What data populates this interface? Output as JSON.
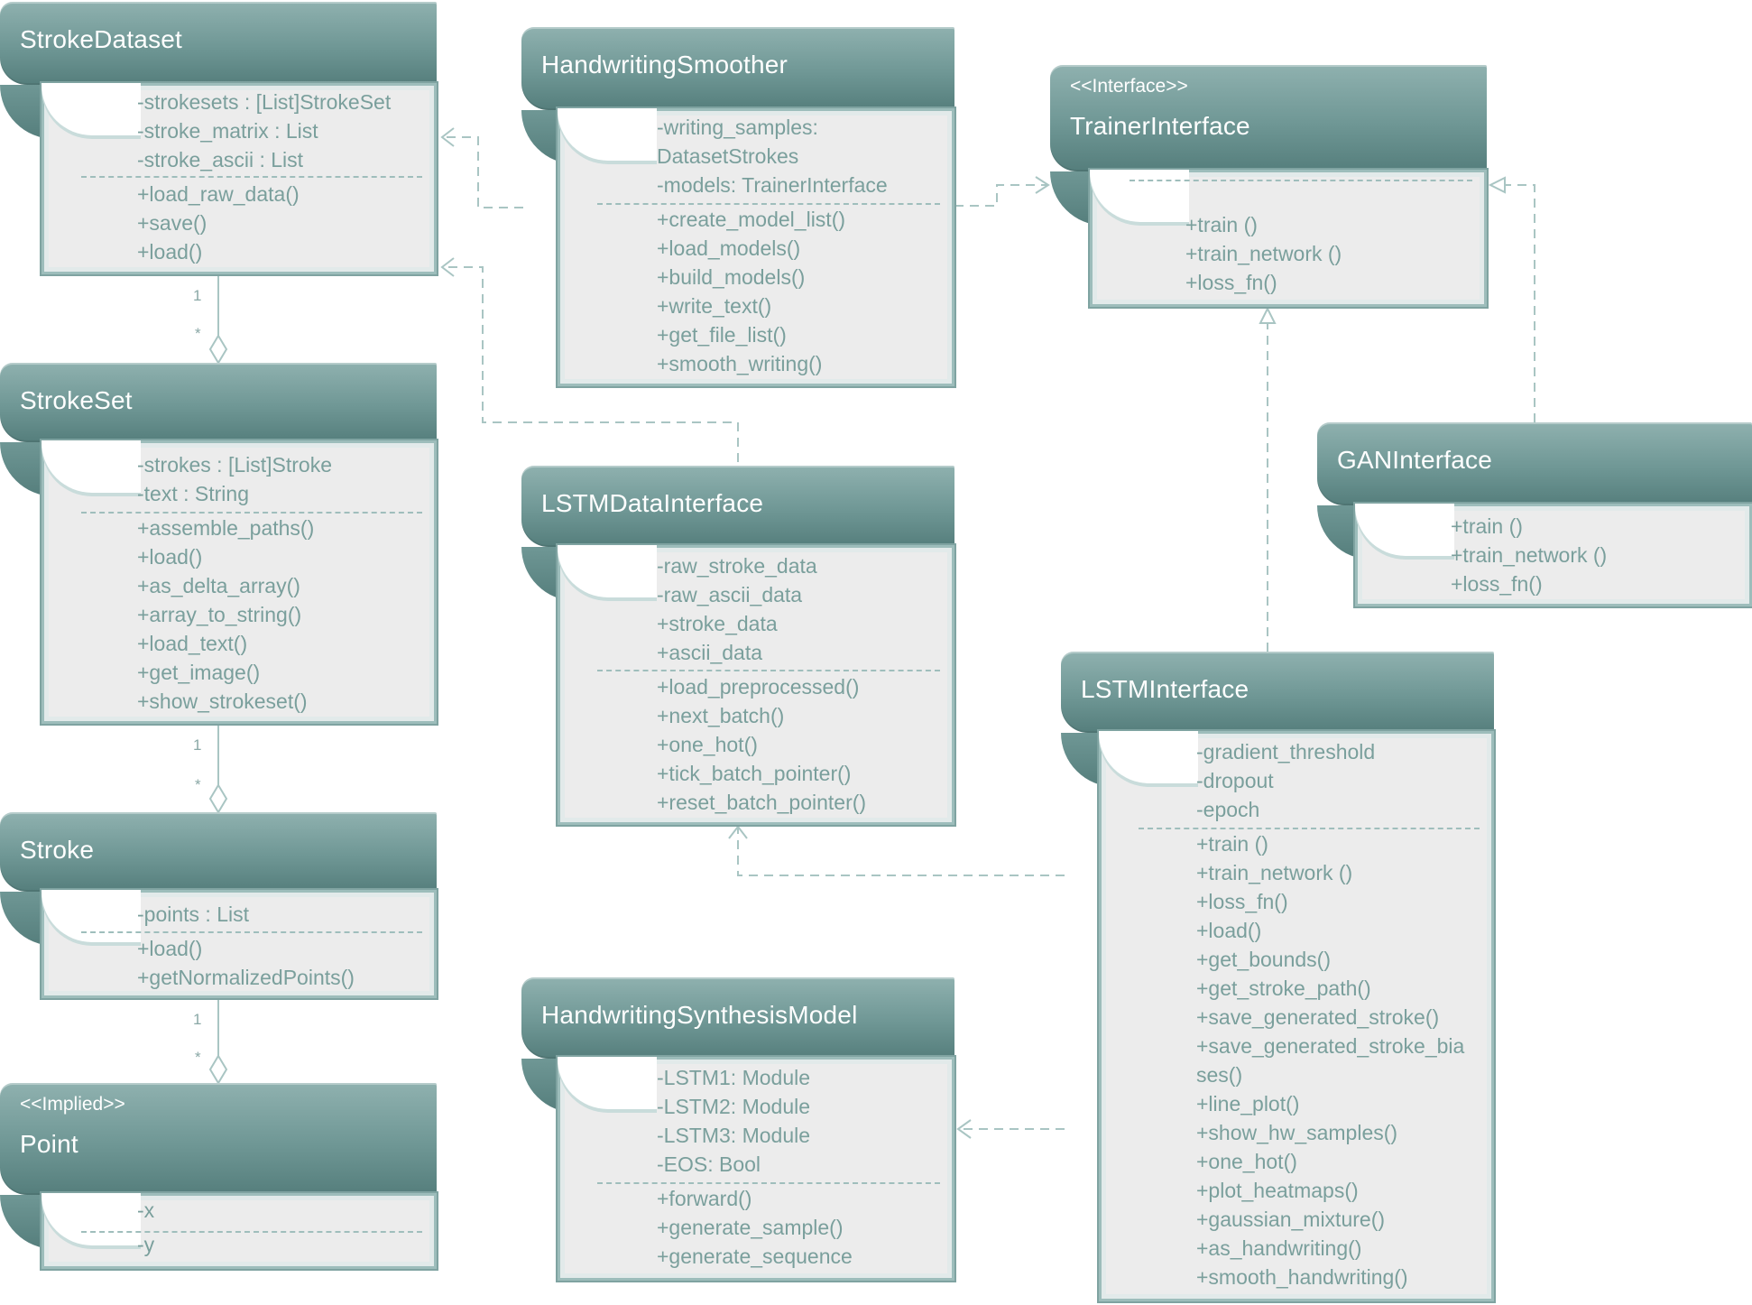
{
  "classes": {
    "stroke_dataset": {
      "name": "StrokeDataset",
      "attributes": [
        "-strokesets : [List]StrokeSet",
        "-stroke_matrix : List",
        "-stroke_ascii : List"
      ],
      "methods": [
        "+load_raw_data()",
        "+save()",
        "+load()"
      ]
    },
    "stroke_set": {
      "name": "StrokeSet",
      "attributes": [
        "-strokes : [List]Stroke",
        "-text : String"
      ],
      "methods": [
        "+assemble_paths()",
        "+load()",
        "+as_delta_array()",
        "+array_to_string()",
        "+load_text()",
        "+get_image()",
        "+show_strokeset()"
      ]
    },
    "stroke": {
      "name": "Stroke",
      "attributes": [
        "-points : List"
      ],
      "methods": [
        "+load()",
        "+getNormalizedPoints()"
      ]
    },
    "point": {
      "stereotype": "<<Implied>>",
      "name": "Point",
      "attributes": [
        "-x"
      ],
      "methods": [
        "-y"
      ]
    },
    "handwriting_smoother": {
      "name": "HandwritingSmoother",
      "attributes": [
        "-writing_samples:",
        "DatasetStrokes",
        "-models: TrainerInterface"
      ],
      "methods": [
        "+create_model_list()",
        "+load_models()",
        "+build_models()",
        "+write_text()",
        "+get_file_list()",
        "+smooth_writing()"
      ]
    },
    "lstm_data_interface": {
      "name": "LSTMDataInterface",
      "attributes": [
        "-raw_stroke_data",
        "-raw_ascii_data",
        "+stroke_data",
        "+ascii_data"
      ],
      "methods": [
        "+load_preprocessed()",
        "+next_batch()",
        "+one_hot()",
        "+tick_batch_pointer()",
        "+reset_batch_pointer()"
      ]
    },
    "handwriting_synthesis_model": {
      "name": "HandwritingSynthesisModel",
      "attributes": [
        "-LSTM1: Module",
        "-LSTM2: Module",
        "-LSTM3: Module",
        "-EOS: Bool"
      ],
      "methods": [
        "+forward()",
        "+generate_sample()",
        "+generate_sequence"
      ]
    },
    "trainer_interface": {
      "stereotype": "<<Interface>>",
      "name": "TrainerInterface",
      "attributes": [],
      "methods": [
        "+train ()",
        "+train_network ()",
        "+loss_fn()"
      ]
    },
    "gan_interface": {
      "name": "GANInterface",
      "attributes": [],
      "methods": [
        "+train ()",
        "+train_network ()",
        "+loss_fn()"
      ]
    },
    "lstm_interface": {
      "name": "LSTMInterface",
      "attributes": [
        "-gradient_threshold",
        "-dropout",
        "-epoch"
      ],
      "methods": [
        "+train ()",
        "+train_network ()",
        "+loss_fn()",
        "+load()",
        "+get_bounds()",
        "+get_stroke_path()",
        "+save_generated_stroke()",
        "+save_generated_stroke_bia",
        "ses()",
        "+line_plot()",
        "+show_hw_samples()",
        "+one_hot()",
        "+plot_heatmaps()",
        "+gaussian_mixture()",
        "+as_handwriting()",
        "+smooth_handwriting()"
      ]
    }
  },
  "multiplicities": {
    "dataset_to_set": {
      "one": "1",
      "many": "*"
    },
    "set_to_stroke": {
      "one": "1",
      "many": "*"
    },
    "stroke_to_point": {
      "one": "1",
      "many": "*"
    }
  },
  "colors": {
    "header": "#6f9795",
    "member_text": "#7a9f9c",
    "body": "#ececec",
    "edge": "#9fbebc"
  }
}
